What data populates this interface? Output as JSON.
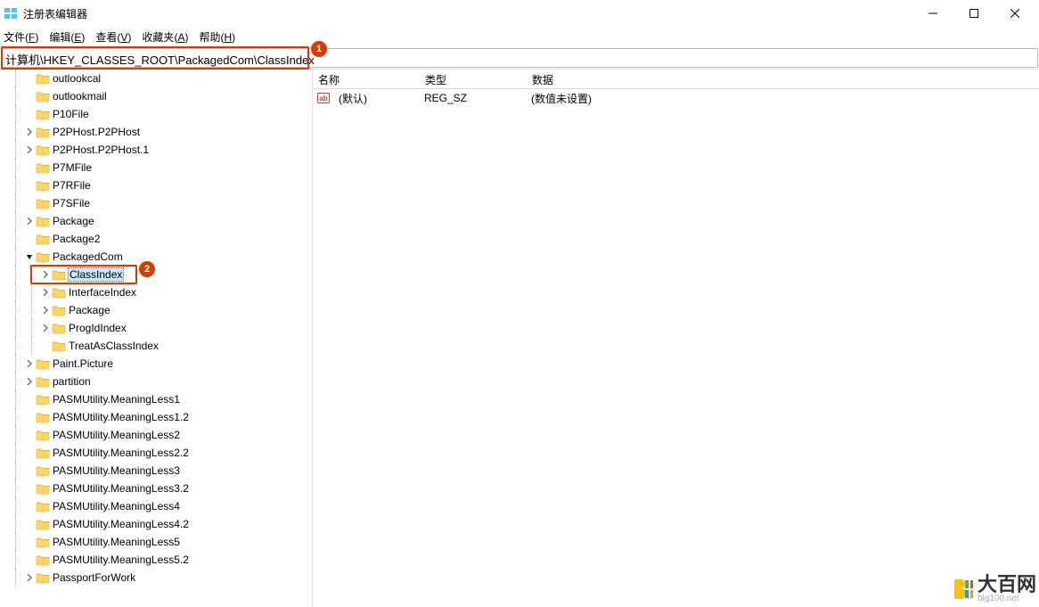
{
  "window": {
    "title": "注册表编辑器"
  },
  "menu": {
    "file": "文件",
    "file_accel": "F",
    "edit": "编辑",
    "edit_accel": "E",
    "view": "查看",
    "view_accel": "V",
    "fav": "收藏夹",
    "fav_accel": "A",
    "help": "帮助",
    "help_accel": "H"
  },
  "address": "计算机\\HKEY_CLASSES_ROOT\\PackagedCom\\ClassIndex",
  "callouts": {
    "c1": "1",
    "c2": "2"
  },
  "tree": [
    {
      "indent": 40,
      "chev": "none",
      "label": "outlookcal"
    },
    {
      "indent": 40,
      "chev": "none",
      "label": "outlookmail"
    },
    {
      "indent": 40,
      "chev": "none",
      "label": "P10File"
    },
    {
      "indent": 40,
      "chev": "closed",
      "label": "P2PHost.P2PHost"
    },
    {
      "indent": 40,
      "chev": "closed",
      "label": "P2PHost.P2PHost.1"
    },
    {
      "indent": 40,
      "chev": "none",
      "label": "P7MFile"
    },
    {
      "indent": 40,
      "chev": "none",
      "label": "P7RFile"
    },
    {
      "indent": 40,
      "chev": "none",
      "label": "P7SFile"
    },
    {
      "indent": 40,
      "chev": "closed",
      "label": "Package"
    },
    {
      "indent": 40,
      "chev": "none",
      "label": "Package2"
    },
    {
      "indent": 40,
      "chev": "open",
      "label": "PackagedCom"
    },
    {
      "indent": 58,
      "chev": "closed",
      "label": "ClassIndex",
      "selected": true,
      "highlight": true
    },
    {
      "indent": 58,
      "chev": "closed",
      "label": "InterfaceIndex"
    },
    {
      "indent": 58,
      "chev": "closed",
      "label": "Package"
    },
    {
      "indent": 58,
      "chev": "closed",
      "label": "ProgIdIndex"
    },
    {
      "indent": 58,
      "chev": "none",
      "label": "TreatAsClassIndex"
    },
    {
      "indent": 40,
      "chev": "closed",
      "label": "Paint.Picture"
    },
    {
      "indent": 40,
      "chev": "closed",
      "label": "partition"
    },
    {
      "indent": 40,
      "chev": "none",
      "label": "PASMUtility.MeaningLess1"
    },
    {
      "indent": 40,
      "chev": "none",
      "label": "PASMUtility.MeaningLess1.2"
    },
    {
      "indent": 40,
      "chev": "none",
      "label": "PASMUtility.MeaningLess2"
    },
    {
      "indent": 40,
      "chev": "none",
      "label": "PASMUtility.MeaningLess2.2"
    },
    {
      "indent": 40,
      "chev": "none",
      "label": "PASMUtility.MeaningLess3"
    },
    {
      "indent": 40,
      "chev": "none",
      "label": "PASMUtility.MeaningLess3.2"
    },
    {
      "indent": 40,
      "chev": "none",
      "label": "PASMUtility.MeaningLess4"
    },
    {
      "indent": 40,
      "chev": "none",
      "label": "PASMUtility.MeaningLess4.2"
    },
    {
      "indent": 40,
      "chev": "none",
      "label": "PASMUtility.MeaningLess5"
    },
    {
      "indent": 40,
      "chev": "none",
      "label": "PASMUtility.MeaningLess5.2"
    },
    {
      "indent": 40,
      "chev": "closed",
      "label": "PassportForWork"
    }
  ],
  "list": {
    "headers": {
      "name": "名称",
      "type": "类型",
      "data": "数据"
    },
    "rows": [
      {
        "name": "(默认)",
        "type": "REG_SZ",
        "data": "(数值未设置)"
      }
    ]
  },
  "watermark": {
    "main": "大百网",
    "sub": "big100.net"
  }
}
